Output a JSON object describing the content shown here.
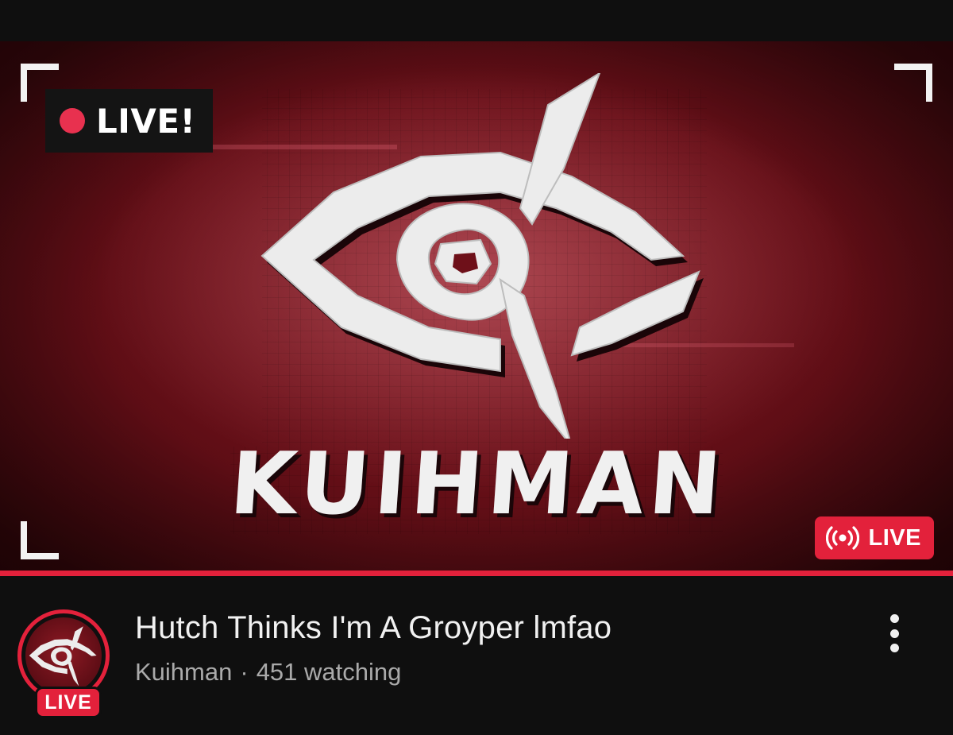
{
  "thumbnail": {
    "overlay_tag": "LIVE!",
    "brand_name": "KUIHMAN",
    "live_badge": "LIVE",
    "accent_color": "#e3213b",
    "background_color": "#6e1019"
  },
  "video": {
    "title": "Hutch Thinks I'm A Groyper lmfao",
    "channel": "Kuihman",
    "separator": "·",
    "viewers": "451 watching"
  },
  "avatar": {
    "live_label": "LIVE"
  },
  "icons": {
    "broadcast": "broadcast-icon",
    "more": "more-vert-icon",
    "eye_logo": "eye-logo-icon"
  }
}
